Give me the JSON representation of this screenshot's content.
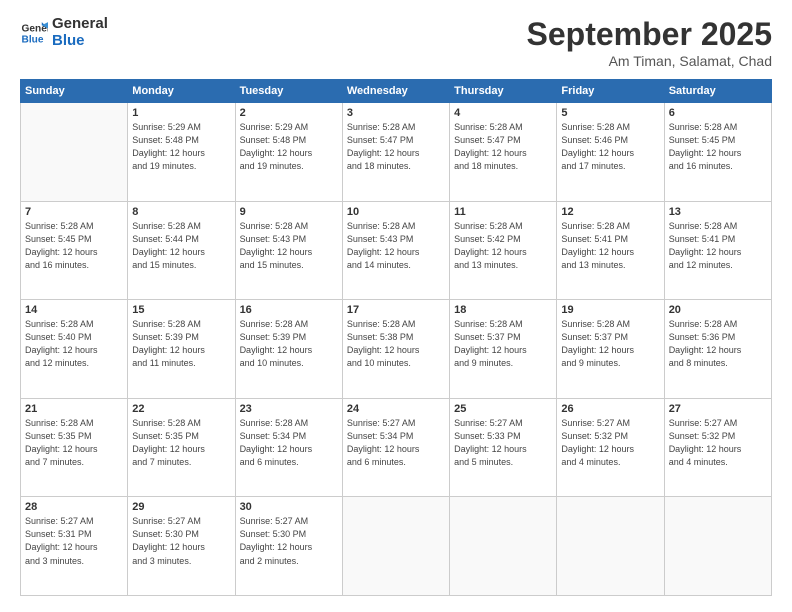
{
  "logo": {
    "line1": "General",
    "line2": "Blue"
  },
  "title": "September 2025",
  "location": "Am Timan, Salamat, Chad",
  "weekdays": [
    "Sunday",
    "Monday",
    "Tuesday",
    "Wednesday",
    "Thursday",
    "Friday",
    "Saturday"
  ],
  "weeks": [
    [
      {
        "day": "",
        "info": ""
      },
      {
        "day": "1",
        "info": "Sunrise: 5:29 AM\nSunset: 5:48 PM\nDaylight: 12 hours\nand 19 minutes."
      },
      {
        "day": "2",
        "info": "Sunrise: 5:29 AM\nSunset: 5:48 PM\nDaylight: 12 hours\nand 19 minutes."
      },
      {
        "day": "3",
        "info": "Sunrise: 5:28 AM\nSunset: 5:47 PM\nDaylight: 12 hours\nand 18 minutes."
      },
      {
        "day": "4",
        "info": "Sunrise: 5:28 AM\nSunset: 5:47 PM\nDaylight: 12 hours\nand 18 minutes."
      },
      {
        "day": "5",
        "info": "Sunrise: 5:28 AM\nSunset: 5:46 PM\nDaylight: 12 hours\nand 17 minutes."
      },
      {
        "day": "6",
        "info": "Sunrise: 5:28 AM\nSunset: 5:45 PM\nDaylight: 12 hours\nand 16 minutes."
      }
    ],
    [
      {
        "day": "7",
        "info": "Sunrise: 5:28 AM\nSunset: 5:45 PM\nDaylight: 12 hours\nand 16 minutes."
      },
      {
        "day": "8",
        "info": "Sunrise: 5:28 AM\nSunset: 5:44 PM\nDaylight: 12 hours\nand 15 minutes."
      },
      {
        "day": "9",
        "info": "Sunrise: 5:28 AM\nSunset: 5:43 PM\nDaylight: 12 hours\nand 15 minutes."
      },
      {
        "day": "10",
        "info": "Sunrise: 5:28 AM\nSunset: 5:43 PM\nDaylight: 12 hours\nand 14 minutes."
      },
      {
        "day": "11",
        "info": "Sunrise: 5:28 AM\nSunset: 5:42 PM\nDaylight: 12 hours\nand 13 minutes."
      },
      {
        "day": "12",
        "info": "Sunrise: 5:28 AM\nSunset: 5:41 PM\nDaylight: 12 hours\nand 13 minutes."
      },
      {
        "day": "13",
        "info": "Sunrise: 5:28 AM\nSunset: 5:41 PM\nDaylight: 12 hours\nand 12 minutes."
      }
    ],
    [
      {
        "day": "14",
        "info": "Sunrise: 5:28 AM\nSunset: 5:40 PM\nDaylight: 12 hours\nand 12 minutes."
      },
      {
        "day": "15",
        "info": "Sunrise: 5:28 AM\nSunset: 5:39 PM\nDaylight: 12 hours\nand 11 minutes."
      },
      {
        "day": "16",
        "info": "Sunrise: 5:28 AM\nSunset: 5:39 PM\nDaylight: 12 hours\nand 10 minutes."
      },
      {
        "day": "17",
        "info": "Sunrise: 5:28 AM\nSunset: 5:38 PM\nDaylight: 12 hours\nand 10 minutes."
      },
      {
        "day": "18",
        "info": "Sunrise: 5:28 AM\nSunset: 5:37 PM\nDaylight: 12 hours\nand 9 minutes."
      },
      {
        "day": "19",
        "info": "Sunrise: 5:28 AM\nSunset: 5:37 PM\nDaylight: 12 hours\nand 9 minutes."
      },
      {
        "day": "20",
        "info": "Sunrise: 5:28 AM\nSunset: 5:36 PM\nDaylight: 12 hours\nand 8 minutes."
      }
    ],
    [
      {
        "day": "21",
        "info": "Sunrise: 5:28 AM\nSunset: 5:35 PM\nDaylight: 12 hours\nand 7 minutes."
      },
      {
        "day": "22",
        "info": "Sunrise: 5:28 AM\nSunset: 5:35 PM\nDaylight: 12 hours\nand 7 minutes."
      },
      {
        "day": "23",
        "info": "Sunrise: 5:28 AM\nSunset: 5:34 PM\nDaylight: 12 hours\nand 6 minutes."
      },
      {
        "day": "24",
        "info": "Sunrise: 5:27 AM\nSunset: 5:34 PM\nDaylight: 12 hours\nand 6 minutes."
      },
      {
        "day": "25",
        "info": "Sunrise: 5:27 AM\nSunset: 5:33 PM\nDaylight: 12 hours\nand 5 minutes."
      },
      {
        "day": "26",
        "info": "Sunrise: 5:27 AM\nSunset: 5:32 PM\nDaylight: 12 hours\nand 4 minutes."
      },
      {
        "day": "27",
        "info": "Sunrise: 5:27 AM\nSunset: 5:32 PM\nDaylight: 12 hours\nand 4 minutes."
      }
    ],
    [
      {
        "day": "28",
        "info": "Sunrise: 5:27 AM\nSunset: 5:31 PM\nDaylight: 12 hours\nand 3 minutes."
      },
      {
        "day": "29",
        "info": "Sunrise: 5:27 AM\nSunset: 5:30 PM\nDaylight: 12 hours\nand 3 minutes."
      },
      {
        "day": "30",
        "info": "Sunrise: 5:27 AM\nSunset: 5:30 PM\nDaylight: 12 hours\nand 2 minutes."
      },
      {
        "day": "",
        "info": ""
      },
      {
        "day": "",
        "info": ""
      },
      {
        "day": "",
        "info": ""
      },
      {
        "day": "",
        "info": ""
      }
    ]
  ]
}
